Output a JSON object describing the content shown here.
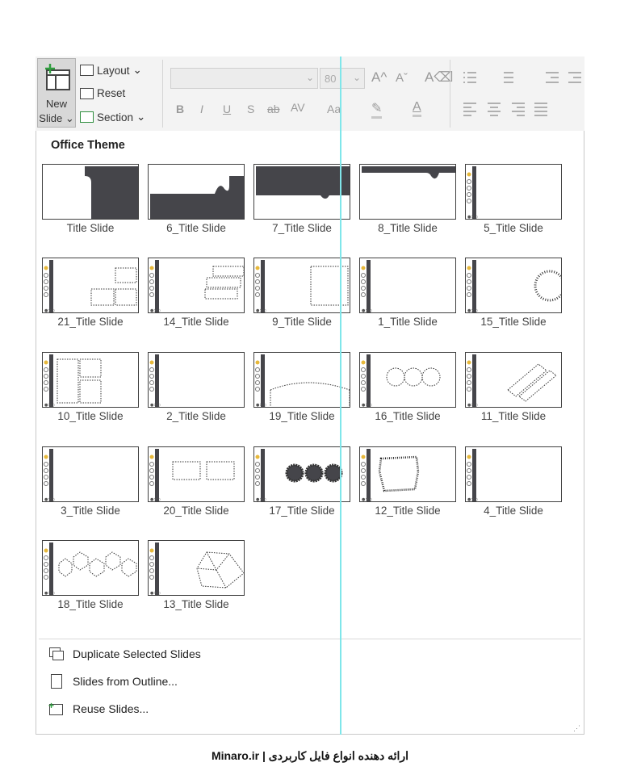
{
  "ribbon": {
    "new_slide_line1": "New",
    "new_slide_line2": "Slide",
    "layout": "Layout",
    "reset": "Reset",
    "section": "Section",
    "font_size": "80",
    "bold": "B",
    "italic": "I",
    "underline": "U",
    "shadow": "S",
    "strike": "ab",
    "spacing": "AV",
    "change_case": "Aa",
    "font_color": "A"
  },
  "gallery": {
    "heading": "Office Theme",
    "slides": [
      {
        "label": "Title Slide",
        "art": "title-tab-right"
      },
      {
        "label": "6_Title Slide",
        "art": "bottom-band"
      },
      {
        "label": "7_Title Slide",
        "art": "top-band-drop"
      },
      {
        "label": "8_Title Slide",
        "art": "top-bar-drop"
      },
      {
        "label": "5_Title Slide",
        "art": "sidebar"
      },
      {
        "label": "21_Title Slide",
        "art": "sidebar-boxes"
      },
      {
        "label": "14_Title Slide",
        "art": "sidebar-stack"
      },
      {
        "label": "9_Title Slide",
        "art": "sidebar-square"
      },
      {
        "label": "1_Title Slide",
        "art": "sidebar"
      },
      {
        "label": "15_Title Slide",
        "art": "sidebar-ring"
      },
      {
        "label": "10_Title Slide",
        "art": "sidebar-grid"
      },
      {
        "label": "2_Title Slide",
        "art": "sidebar"
      },
      {
        "label": "19_Title Slide",
        "art": "sidebar-arc"
      },
      {
        "label": "16_Title Slide",
        "art": "sidebar-circles"
      },
      {
        "label": "11_Title Slide",
        "art": "sidebar-diagonal"
      },
      {
        "label": "3_Title Slide",
        "art": "sidebar"
      },
      {
        "label": "20_Title Slide",
        "art": "sidebar-two-boxes"
      },
      {
        "label": "17_Title Slide",
        "art": "sidebar-gears"
      },
      {
        "label": "12_Title Slide",
        "art": "sidebar-rough"
      },
      {
        "label": "4_Title Slide",
        "art": "sidebar"
      },
      {
        "label": "18_Title Slide",
        "art": "sidebar-hexes"
      },
      {
        "label": "13_Title Slide",
        "art": "sidebar-poly"
      }
    ]
  },
  "menu": {
    "duplicate": "Duplicate Selected Slides",
    "outline": "Slides from Outline...",
    "reuse": "Reuse Slides..."
  },
  "footer": "Minaro.ir | ارائه دهنده انواع فایل کاربردی"
}
